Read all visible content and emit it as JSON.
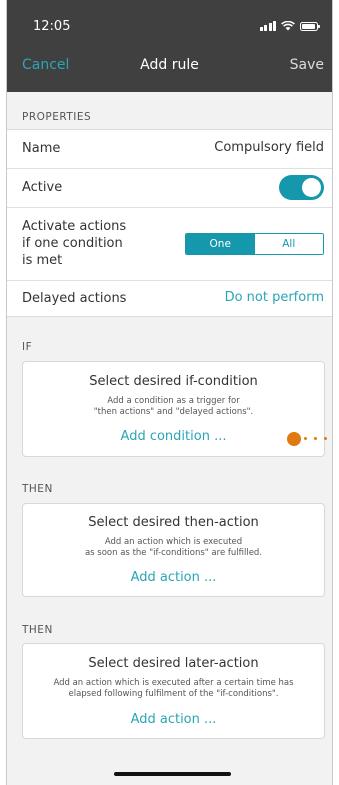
{
  "status_bar": {
    "time": "12:05"
  },
  "nav": {
    "cancel": "Cancel",
    "title": "Add rule",
    "save": "Save"
  },
  "properties": {
    "section_title": "PROPERTIES",
    "name_label": "Name",
    "name_value": "Compulsory field",
    "active_label": "Active",
    "active_on": true,
    "activate_label_lines": [
      "Activate actions",
      "if one condition",
      "is met"
    ],
    "segment_options": [
      "One",
      "All"
    ],
    "segment_selected": "One",
    "delayed_label": "Delayed actions",
    "delayed_value": "Do not perform"
  },
  "if_section": {
    "section_title": "IF",
    "card_title": "Select desired if-condition",
    "card_desc_lines": [
      "Add a condition as a trigger for",
      "\"then actions\" and \"delayed actions\"."
    ],
    "card_link": "Add condition ..."
  },
  "then_section": {
    "section_title": "THEN",
    "card_title": "Select desired then-action",
    "card_desc_lines": [
      "Add an action which is executed",
      "as soon as the \"if-conditions\" are fulfilled."
    ],
    "card_link": "Add action ..."
  },
  "later_section": {
    "section_title": "THEN",
    "card_title": "Select desired later-action",
    "card_desc_lines": [
      "Add an action which is executed after a certain time has",
      "elapsed following fulfilment of the \"if-conditions\"."
    ],
    "card_link": "Add action ..."
  },
  "colors": {
    "accent": "#1698ac",
    "link": "#2aa5b7",
    "header": "#404040",
    "orange": "#e07a10"
  }
}
